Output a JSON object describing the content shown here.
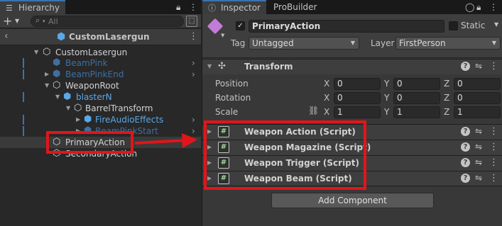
{
  "hierarchy": {
    "tab_label": "Hierarchy",
    "search": {
      "placeholder": "All"
    },
    "scene_title": "CustomLasergun",
    "items": [
      {
        "label": "CustomLasergun"
      },
      {
        "label": "BeamPink"
      },
      {
        "label": "BeamPinkEnd"
      },
      {
        "label": "WeaponRoot"
      },
      {
        "label": "blasterN"
      },
      {
        "label": "BarrelTransform"
      },
      {
        "label": "FireAudioEffects"
      },
      {
        "label": "BeamPinkStart"
      },
      {
        "label": "PrimaryAction"
      },
      {
        "label": "SecondaryAction"
      }
    ]
  },
  "inspector": {
    "tabs": [
      {
        "label": "Inspector"
      },
      {
        "label": "ProBuilder"
      }
    ],
    "object_name": "PrimaryAction",
    "static_label": "Static",
    "tag_label": "Tag",
    "tag_value": "Untagged",
    "layer_label": "Layer",
    "layer_value": "FirstPerson",
    "transform": {
      "title": "Transform",
      "rows": [
        {
          "label": "Position",
          "x": "0",
          "y": "0",
          "z": "0"
        },
        {
          "label": "Rotation",
          "x": "0",
          "y": "0",
          "z": "0"
        },
        {
          "label": "Scale",
          "x": "1",
          "y": "1",
          "z": "1"
        }
      ],
      "axes": {
        "x": "X",
        "y": "Y",
        "z": "Z"
      }
    },
    "components": [
      {
        "title": "Weapon Action (Script)"
      },
      {
        "title": "Weapon Magazine (Script)"
      },
      {
        "title": "Weapon Trigger (Script)"
      },
      {
        "title": "Weapon Beam (Script)"
      }
    ],
    "add_component_label": "Add Component"
  },
  "colors": {
    "annotation_red": "#e0161b",
    "prefab_blue": "#5aa8e8",
    "selection_bg": "#3a3a3a"
  }
}
